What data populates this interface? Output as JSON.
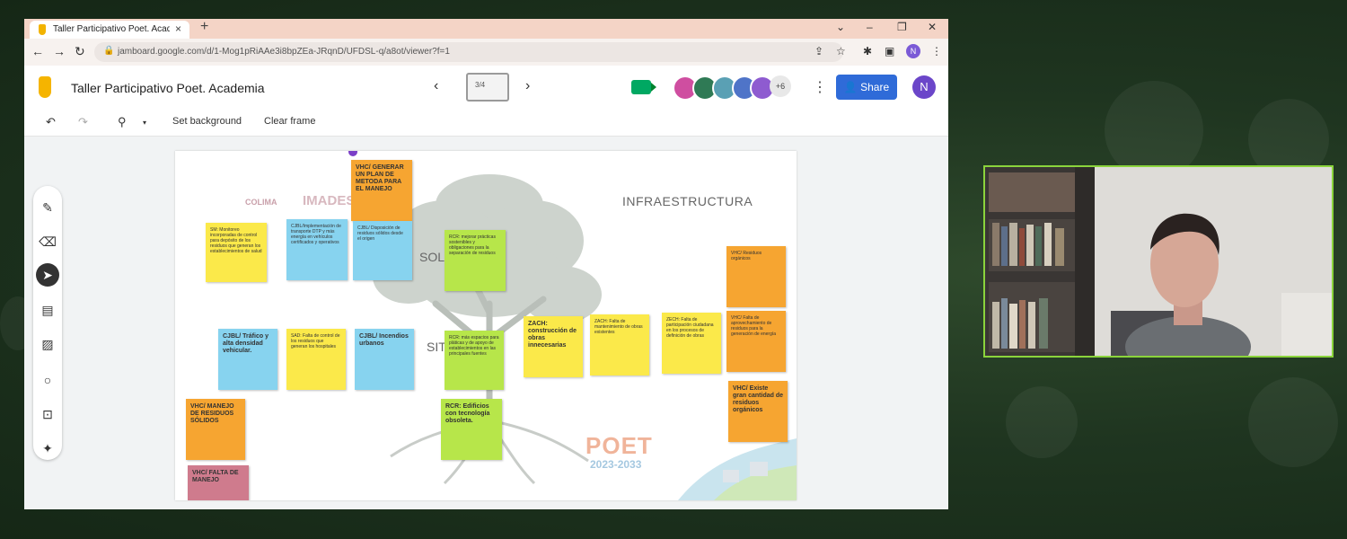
{
  "browser": {
    "tab_title": "Taller Participativo Poet. Academia",
    "tab_close": "×",
    "new_tab": "+",
    "window_controls": [
      "⌄",
      "–",
      "❐",
      "✕"
    ],
    "url": "jamboard.google.com/d/1-Mog1pRiAAe3i8bpZEa-JRqnD/UFDSL-q/a8ot/viewer?f=1",
    "profile_initial": "N"
  },
  "app": {
    "title": "Taller Participativo Poet. Academia",
    "frame_indicator": "3/4",
    "avatar_colors": [
      "#cf4ea0",
      "#2f7a55",
      "#5aa0b4",
      "#4f74c8",
      "#8e5bd0"
    ],
    "more_participants": "+6",
    "share_label": "Share",
    "account_initial": "N"
  },
  "toolbar": {
    "set_background": "Set background",
    "clear_frame": "Clear frame"
  },
  "board": {
    "logo_colima": "COLIMA",
    "logo_imades": "IMADES",
    "heading_infra": "INFRAESTRUCTURA",
    "label_soluciones": "SOLUCIONES",
    "label_sit": "SIT",
    "poet": "POET",
    "poet_years": "2023-2033",
    "notes": [
      {
        "text": "VHC/ GENERAR UN PLAN DE METODA PARA EL MANEJO"
      },
      {
        "text": "SM: Monitoreo incorporadas de control para depósito de los residuos que generan los establecimientos de salud"
      },
      {
        "text": "CJBL/Implementación de transporte DTP y más energía en vehículos certificados y operativos"
      },
      {
        "text": "CJBL/ Disposición de residuos sólidos desde el origen"
      },
      {
        "text": "RCR: mejorar prácticas sostenibles y obligaciones para la separación de residuos"
      },
      {
        "text": "CJBL/ Tráfico y alta densidad vehicular."
      },
      {
        "text": "SAD: Falta de control de los residuos que generan los hospitales"
      },
      {
        "text": "CJBL/ Incendios urbanos"
      },
      {
        "text": "RCR: más espacios para pláticas y de apoyo de establecimientos en las principales fuentes"
      },
      {
        "text": "ZACH: construcción de obras innecesarias"
      },
      {
        "text": "ZACH: Falta de mantenimiento de obras existentes"
      },
      {
        "text": "ZECH: Falta de participación ciudadana en los procesos de definición de obras"
      },
      {
        "text": "VHC/ Residuos orgánicos"
      },
      {
        "text": "VHC/ Falta de aprovechamiento de residuos para la generación de energía"
      },
      {
        "text": "VHC/ Existe gran cantidad de residuos orgánicos"
      },
      {
        "text": "VHC/ MANEJO DE RESIDUOS SÓLIDOS"
      },
      {
        "text": "RCR: Edificios con tecnología obsoleta."
      },
      {
        "text": "VHC/ FALTA DE MANEJO"
      }
    ]
  },
  "video": {}
}
